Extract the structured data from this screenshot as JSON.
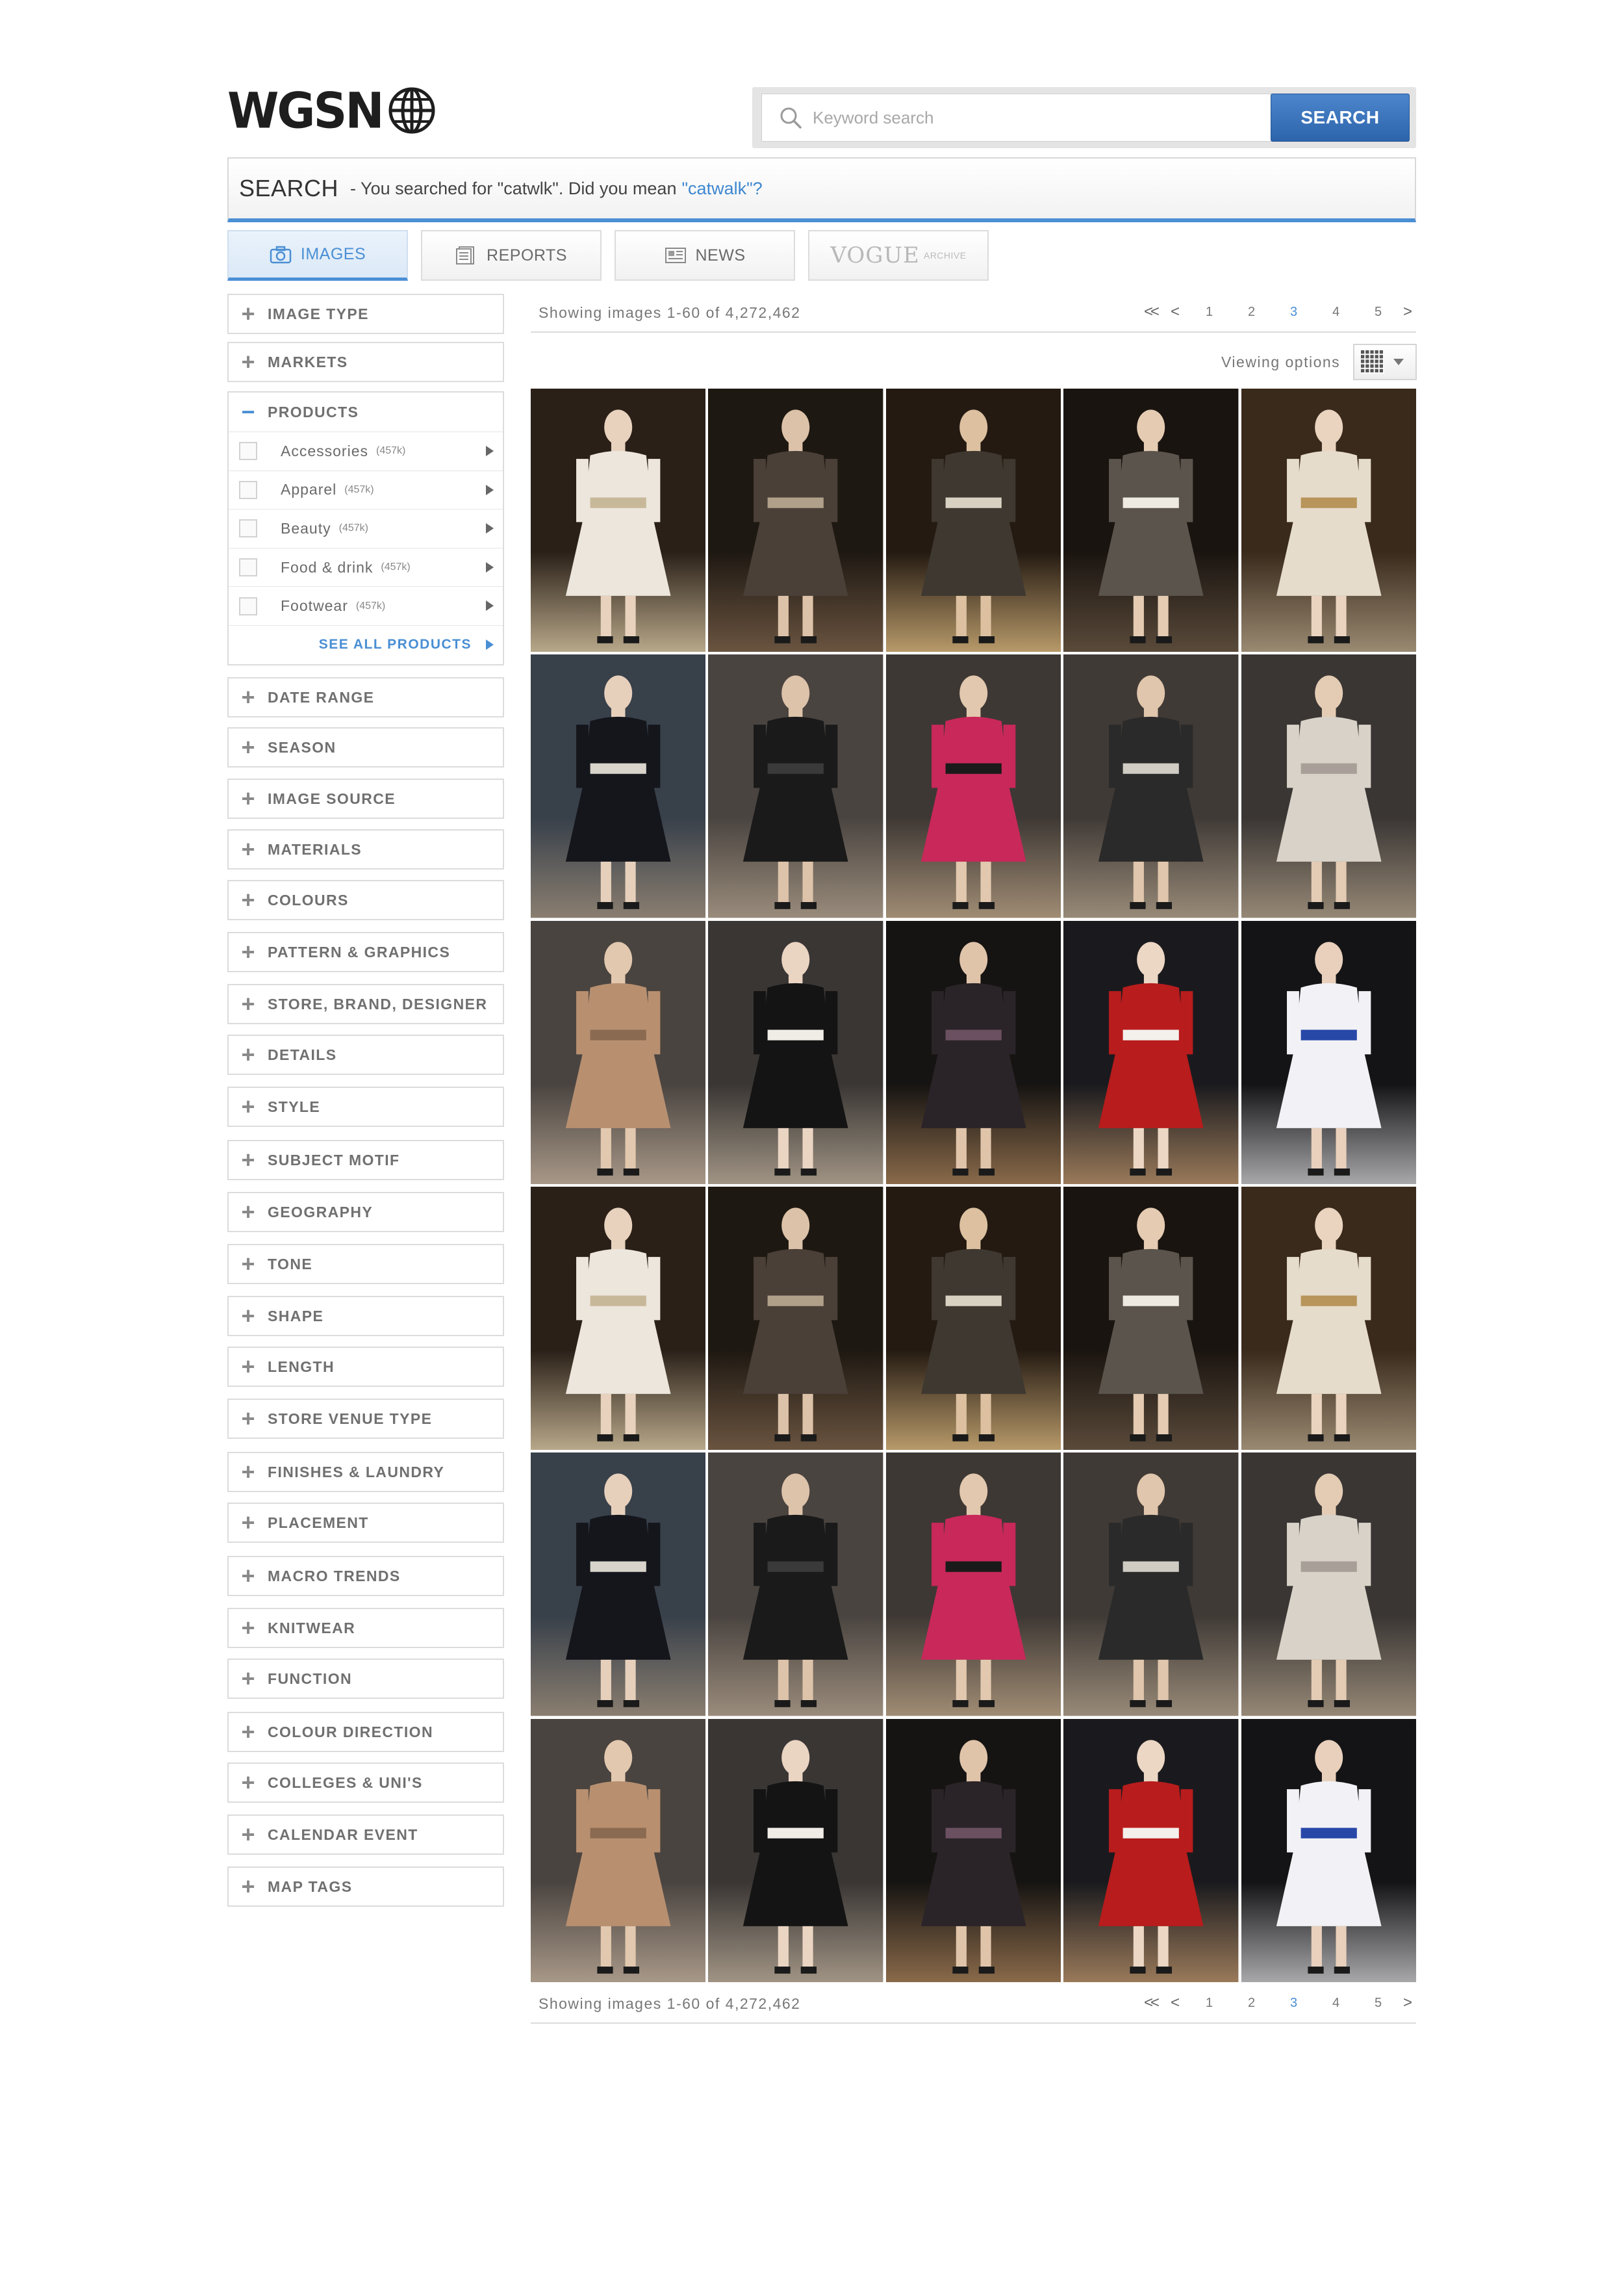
{
  "brand": {
    "name": "WGSN"
  },
  "search": {
    "placeholder": "Keyword search",
    "button_label": "SEARCH",
    "bar_title": "SEARCH",
    "message": "- You searched for \"catwlk\". Did you mean",
    "suggestion": "\"catwalk\"?"
  },
  "tabs": [
    {
      "label": "IMAGES",
      "icon": "camera-icon",
      "active": true
    },
    {
      "label": "REPORTS",
      "icon": "reports-icon",
      "active": false
    },
    {
      "label": "NEWS",
      "icon": "news-icon",
      "active": false
    },
    {
      "label": "VOGUE",
      "sublabel": "ARCHIVE",
      "icon": "vogue-logo",
      "active": false
    }
  ],
  "facets_top": [
    "IMAGE TYPE",
    "MARKETS"
  ],
  "products": {
    "label": "PRODUCTS",
    "items": [
      {
        "label": "Accessories",
        "count": "(457k)"
      },
      {
        "label": "Apparel",
        "count": "(457k)"
      },
      {
        "label": "Beauty",
        "count": "(457k)"
      },
      {
        "label": "Food & drink",
        "count": "(457k)"
      },
      {
        "label": "Footwear",
        "count": "(457k)"
      }
    ],
    "see_all": "SEE ALL PRODUCTS"
  },
  "facets": [
    "DATE RANGE",
    "SEASON",
    "IMAGE SOURCE",
    "MATERIALS",
    "COLOURS",
    "PATTERN & GRAPHICS",
    "STORE, BRAND, DESIGNER",
    "DETAILS",
    "STYLE",
    "SUBJECT MOTIF",
    "GEOGRAPHY",
    "TONE",
    "SHAPE",
    "LENGTH",
    "STORE VENUE TYPE",
    "FINISHES & LAUNDRY",
    "PLACEMENT",
    "MACRO TRENDS",
    "KNITWEAR",
    "FUNCTION",
    "COLOUR DIRECTION",
    "COLLEGES & UNI'S",
    "CALENDAR EVENT",
    "MAP TAGS"
  ],
  "results": {
    "count_text": "Showing images 1-60 of 4,272,462",
    "pages": [
      "1",
      "2",
      "3",
      "4",
      "5"
    ],
    "current_page": "3",
    "first_label": "<<",
    "prev_label": "<",
    "next_label": ">",
    "viewing_options": "Viewing options"
  },
  "images": [
    {
      "bg": "#2a2018",
      "floor": "#b8a88a",
      "dress": "#ece6dc",
      "accent": "#c8b89a",
      "skin": "#e8d2be"
    },
    {
      "bg": "#1e1812",
      "floor": "#6a5440",
      "dress": "#4a4038",
      "accent": "#b0a08a",
      "skin": "#dcc2a8"
    },
    {
      "bg": "#241a12",
      "floor": "#b89a6a",
      "dress": "#3e3830",
      "accent": "#d8d0c0",
      "skin": "#dcc0a0"
    },
    {
      "bg": "#1a1410",
      "floor": "#5a4a3a",
      "dress": "#5a544c",
      "accent": "#eeeae2",
      "skin": "#e4cbb2"
    },
    {
      "bg": "#3a2a1c",
      "floor": "#9a8a72",
      "dress": "#e6dccc",
      "accent": "#b8955a",
      "skin": "#ead4bf"
    },
    {
      "bg": "#38404a",
      "floor": "#8a7e70",
      "dress": "#14161c",
      "accent": "#d8d4cc",
      "skin": "#e6d0bc"
    },
    {
      "bg": "#4a4440",
      "floor": "#9a8c7c",
      "dress": "#1a1a1a",
      "accent": "#3a3a3a",
      "skin": "#ddc3aa"
    },
    {
      "bg": "#3e3834",
      "floor": "#a08c74",
      "dress": "#c8285a",
      "accent": "#1a1a1a",
      "skin": "#e2c8ae"
    },
    {
      "bg": "#403a36",
      "floor": "#988a78",
      "dress": "#2a2a2a",
      "accent": "#d0ccc4",
      "skin": "#e0c6ac"
    },
    {
      "bg": "#3a3634",
      "floor": "#968876",
      "dress": "#d8d2c8",
      "accent": "#a8a098",
      "skin": "#e4ccb4"
    },
    {
      "bg": "#4a4440",
      "floor": "#a89888",
      "dress": "#b89070",
      "accent": "#8a6a50",
      "skin": "#e2c8ae"
    },
    {
      "bg": "#3a3634",
      "floor": "#a09484",
      "dress": "#141414",
      "accent": "#f0ece6",
      "skin": "#ead4c2"
    },
    {
      "bg": "#161412",
      "floor": "#8a6a4a",
      "dress": "#2a2428",
      "accent": "#6a5060",
      "skin": "#e0c4aa"
    },
    {
      "bg": "#1a1a1e",
      "floor": "#9a7a5a",
      "dress": "#b81c1c",
      "accent": "#f4f0ec",
      "skin": "#ecd6c4"
    },
    {
      "bg": "#141416",
      "floor": "#a8a8aa",
      "dress": "#f2f2f6",
      "accent": "#2848a8",
      "skin": "#e8d0bc"
    },
    {
      "bg": "#2a2018",
      "floor": "#b8a88a",
      "dress": "#ece6dc",
      "accent": "#c8b89a",
      "skin": "#e8d2be"
    },
    {
      "bg": "#1e1812",
      "floor": "#6a5440",
      "dress": "#4a4038",
      "accent": "#b0a08a",
      "skin": "#dcc2a8"
    },
    {
      "bg": "#241a12",
      "floor": "#b89a6a",
      "dress": "#3e3830",
      "accent": "#d8d0c0",
      "skin": "#dcc0a0"
    },
    {
      "bg": "#1a1410",
      "floor": "#5a4a3a",
      "dress": "#5a544c",
      "accent": "#eeeae2",
      "skin": "#e4cbb2"
    },
    {
      "bg": "#3a2a1c",
      "floor": "#9a8a72",
      "dress": "#e6dccc",
      "accent": "#b8955a",
      "skin": "#ead4bf"
    },
    {
      "bg": "#38404a",
      "floor": "#8a7e70",
      "dress": "#14161c",
      "accent": "#d8d4cc",
      "skin": "#e6d0bc"
    },
    {
      "bg": "#4a4440",
      "floor": "#9a8c7c",
      "dress": "#1a1a1a",
      "accent": "#3a3a3a",
      "skin": "#ddc3aa"
    },
    {
      "bg": "#3e3834",
      "floor": "#a08c74",
      "dress": "#c8285a",
      "accent": "#1a1a1a",
      "skin": "#e2c8ae"
    },
    {
      "bg": "#403a36",
      "floor": "#988a78",
      "dress": "#2a2a2a",
      "accent": "#d0ccc4",
      "skin": "#e0c6ac"
    },
    {
      "bg": "#3a3634",
      "floor": "#968876",
      "dress": "#d8d2c8",
      "accent": "#a8a098",
      "skin": "#e4ccb4"
    },
    {
      "bg": "#4a4440",
      "floor": "#a89888",
      "dress": "#b89070",
      "accent": "#8a6a50",
      "skin": "#e2c8ae"
    },
    {
      "bg": "#3a3634",
      "floor": "#a09484",
      "dress": "#141414",
      "accent": "#f0ece6",
      "skin": "#ead4c2"
    },
    {
      "bg": "#161412",
      "floor": "#8a6a4a",
      "dress": "#2a2428",
      "accent": "#6a5060",
      "skin": "#e0c4aa"
    },
    {
      "bg": "#1a1a1e",
      "floor": "#9a7a5a",
      "dress": "#b81c1c",
      "accent": "#f4f0ec",
      "skin": "#ecd6c4"
    },
    {
      "bg": "#141416",
      "floor": "#a8a8aa",
      "dress": "#f2f2f6",
      "accent": "#2848a8",
      "skin": "#e8d0bc"
    }
  ],
  "colors": {
    "accent": "#4a8fd4",
    "search_button": "#3a74bd",
    "border": "#dcdcdc"
  }
}
